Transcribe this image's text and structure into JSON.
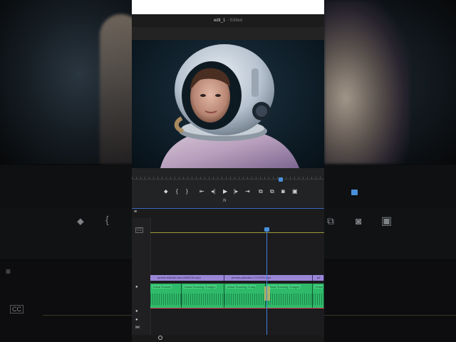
{
  "header": {
    "project_name": "edit_1",
    "status": "- Edited"
  },
  "transport": {
    "buttons": [
      {
        "name": "marker",
        "glyph": "⬥"
      },
      {
        "name": "in-point",
        "glyph": "{"
      },
      {
        "name": "out-point",
        "glyph": "}"
      },
      {
        "name": "go-to-in",
        "glyph": "⇤"
      },
      {
        "name": "step-back",
        "glyph": "◂|"
      },
      {
        "name": "play",
        "glyph": "▶"
      },
      {
        "name": "step-forward",
        "glyph": "|▸"
      },
      {
        "name": "go-to-out",
        "glyph": "⇥"
      },
      {
        "name": "insert",
        "glyph": "⧉"
      },
      {
        "name": "overwrite",
        "glyph": "⧉"
      },
      {
        "name": "export-frame",
        "glyph": "◙"
      },
      {
        "name": "multi-cam",
        "glyph": "▣"
      }
    ],
    "fx_label": "fx"
  },
  "timeline": {
    "menu_glyph": "≡",
    "cc_label": "CC",
    "video_clips": [
      {
        "label": "pexels-mikhail-nilov-6930230.mp4"
      },
      {
        "label": "pexels-cottonbro-7170709.mp4"
      },
      {
        "label": "pe"
      }
    ],
    "audio_clips": [
      {
        "label": "Virtual Roamin"
      },
      {
        "label": "Virtual Roaming Charges"
      },
      {
        "label": "Virtual Roaming Charg"
      },
      {
        "label": "Virtual Roaming Charges"
      },
      {
        "label": "Virtual"
      }
    ]
  },
  "colors": {
    "accent": "#4a8fd9",
    "video_clip": "#9a86d6",
    "audio_clip": "#2fba6a",
    "red_track_line": "#d64a5a"
  }
}
